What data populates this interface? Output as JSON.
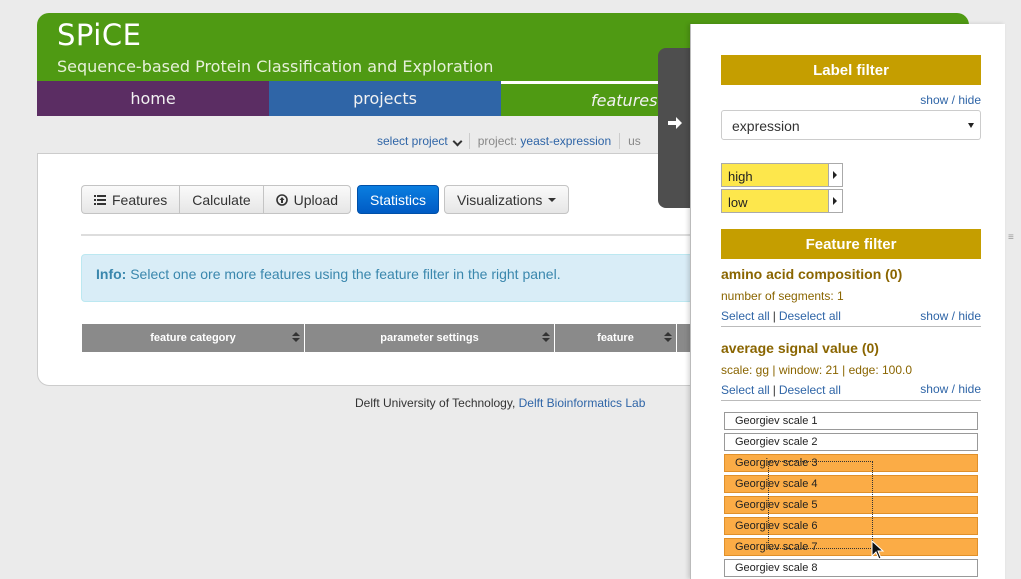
{
  "header": {
    "title": "SPiCE",
    "subtitle": "Sequence-based Protein Classification and Exploration"
  },
  "nav": {
    "home": "home",
    "projects": "projects",
    "features": "features"
  },
  "subbar": {
    "select_project": "select project",
    "project_label": "project:",
    "project_value": "yeast-expression",
    "user_prefix": "us"
  },
  "toolbar": {
    "features": "Features",
    "calculate": "Calculate",
    "upload": "Upload",
    "statistics": "Statistics",
    "visualizations": "Visualizations"
  },
  "info": {
    "label": "Info:",
    "text": "Select one ore more features using the feature filter in the right panel."
  },
  "table": {
    "columns": [
      "feature category",
      "parameter settings",
      "feature"
    ]
  },
  "footer": {
    "text": "Delft University of Technology,",
    "link": "Delft Bioinformatics Lab"
  },
  "panel": {
    "label_filter": {
      "title": "Label filter",
      "show_hide": "show / hide",
      "select_value": "expression",
      "labels": [
        "high",
        "low"
      ]
    },
    "feature_filter": {
      "title": "Feature filter",
      "categories": [
        {
          "title": "amino acid composition (0)",
          "meta": "number of segments: 1",
          "select_all": "Select all",
          "deselect_all": "Deselect all",
          "show_hide": "show / hide"
        },
        {
          "title": "average signal value (0)",
          "meta": "scale: gg | window: 21 | edge: 100.0",
          "select_all": "Select all",
          "deselect_all": "Deselect all",
          "show_hide": "show / hide"
        }
      ],
      "features": [
        {
          "name": "Georgiev scale 1",
          "selected": false
        },
        {
          "name": "Georgiev scale 2",
          "selected": false
        },
        {
          "name": "Georgiev scale 3",
          "selected": true
        },
        {
          "name": "Georgiev scale 4",
          "selected": true
        },
        {
          "name": "Georgiev scale 5",
          "selected": true
        },
        {
          "name": "Georgiev scale 6",
          "selected": true
        },
        {
          "name": "Georgiev scale 7",
          "selected": true
        },
        {
          "name": "Georgiev scale 8",
          "selected": false
        }
      ]
    }
  },
  "colors": {
    "banner": "#4f9a13",
    "nav_home": "#5b2d63",
    "nav_projects": "#2f65a7",
    "filter_header": "#c59e00",
    "label_tag": "#fde74c",
    "feature_selected": "#fbac46",
    "primary_button": "#005bc4"
  }
}
